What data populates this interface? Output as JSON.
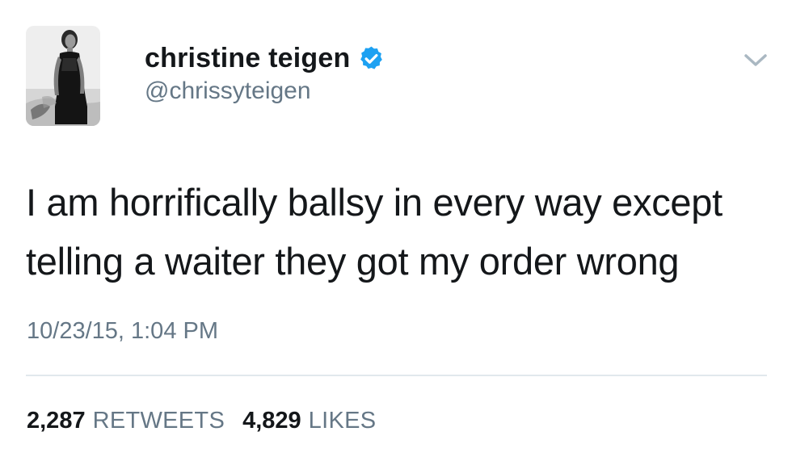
{
  "author": {
    "display_name": "christine teigen",
    "handle": "@chrissyteigen",
    "verified": true,
    "avatar_icon": "profile-photo-woman-black-dress"
  },
  "tweet": {
    "text": "I am horrifically ballsy in every way except telling a waiter they got my order wrong",
    "timestamp": "10/23/15, 1:04 PM"
  },
  "stats": {
    "retweets_count": "2,287",
    "retweets_label": "RETWEETS",
    "likes_count": "4,829",
    "likes_label": "LIKES"
  },
  "colors": {
    "text_primary": "#14171a",
    "text_secondary": "#657786",
    "verified_blue": "#1da1f2",
    "divider": "#e1e8ed"
  },
  "icons": {
    "verified": "verified-badge-icon",
    "menu": "chevron-down-icon"
  }
}
